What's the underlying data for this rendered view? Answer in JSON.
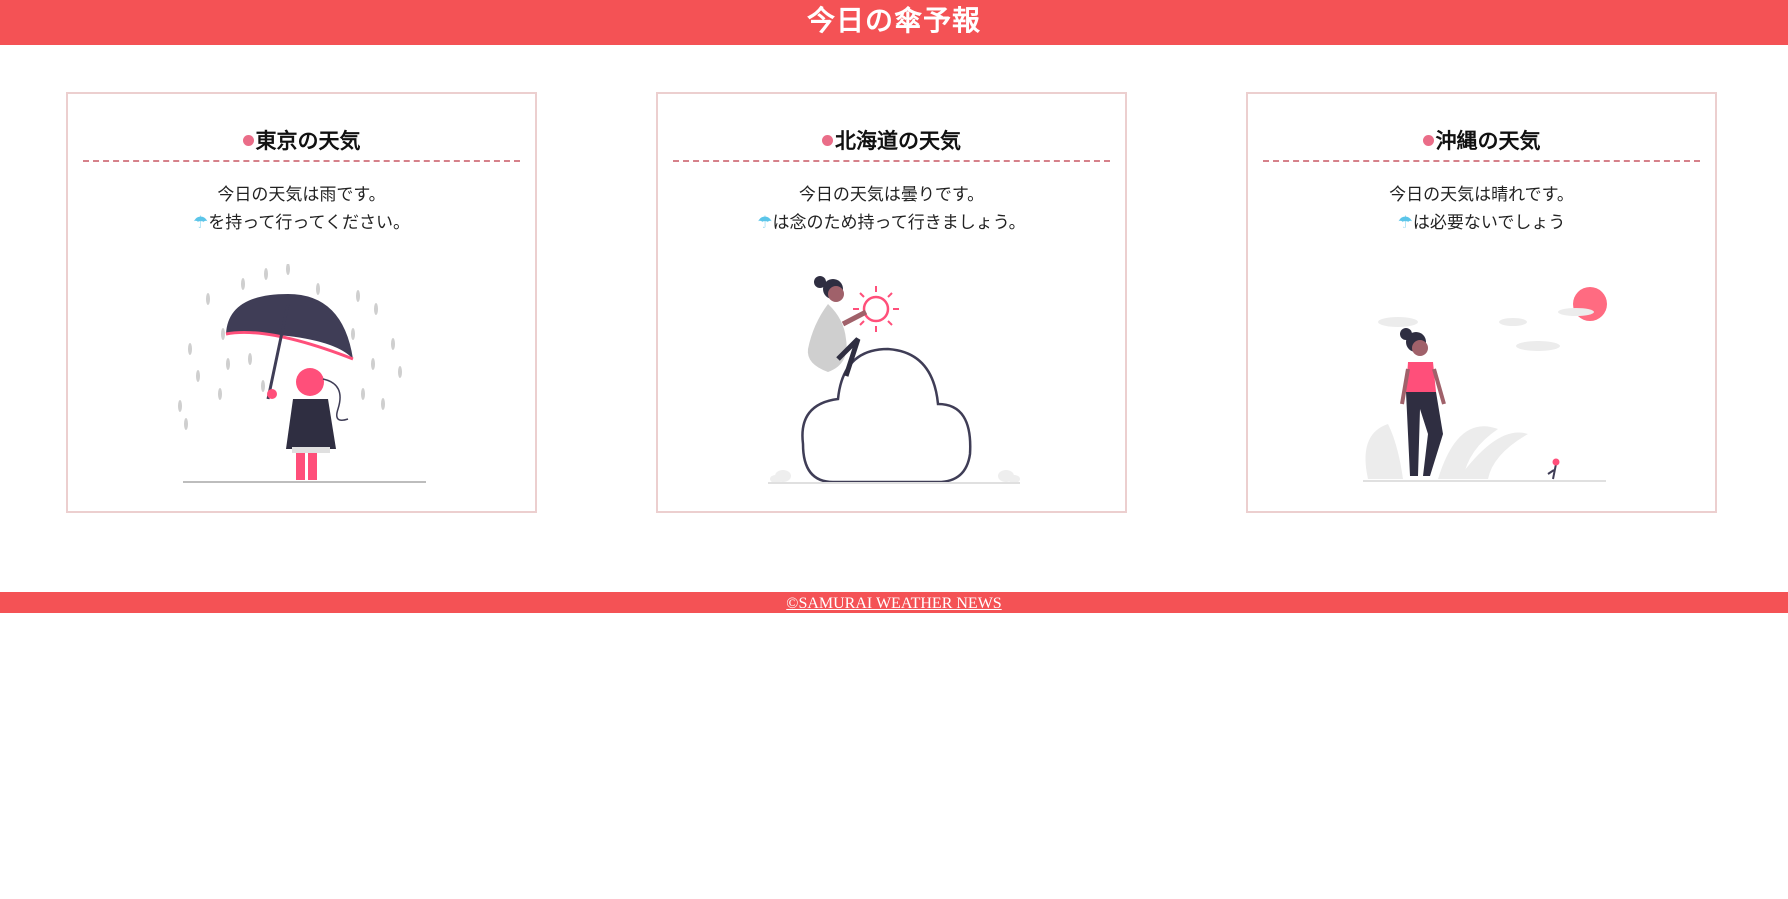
{
  "header": {
    "title": "今日の傘予報"
  },
  "cards": [
    {
      "title": "東京の天気",
      "line1": "今日の天気は雨です。",
      "umbrella": "☂",
      "line2": "を持って行ってください。",
      "illustration": "woman-with-umbrella-in-rain"
    },
    {
      "title": "北海道の天気",
      "line1": "今日の天気は曇りです。",
      "umbrella": "☂",
      "line2": "は念のため持って行きましょう。",
      "illustration": "woman-sitting-on-cloud-with-sun"
    },
    {
      "title": "沖縄の天気",
      "line1": "今日の天気は晴れです。",
      "umbrella": "☂",
      "line2": "は必要ないでしょう",
      "illustration": "woman-walking-in-sunshine"
    }
  ],
  "footer": {
    "copyright": "©SAMURAI WEATHER NEWS"
  },
  "colors": {
    "accent": "#f45255",
    "card_border": "#eccfcf",
    "title_dot": "#ea6d88",
    "umbrella_icon": "#5bc5e9",
    "illustration_pink": "#ff4f7a",
    "illustration_dark": "#3f3d56"
  }
}
